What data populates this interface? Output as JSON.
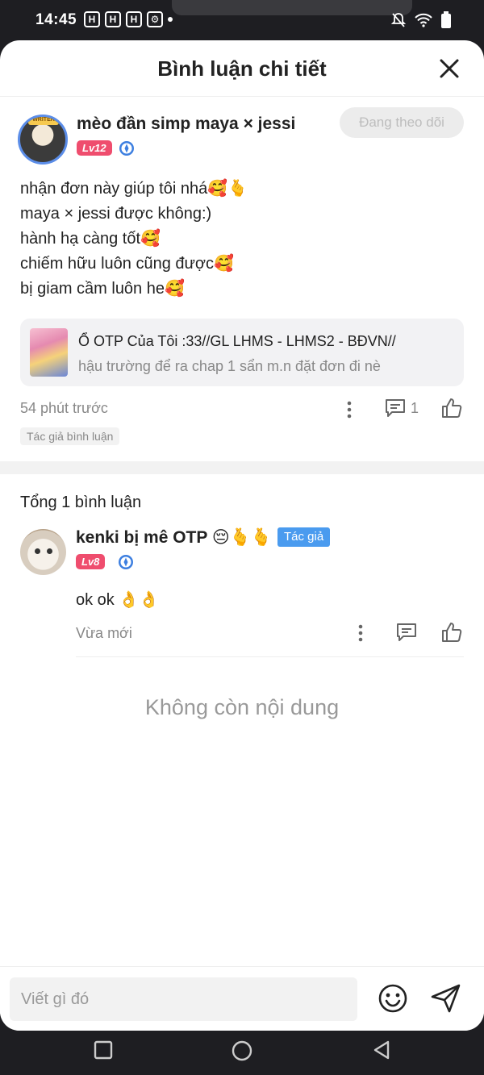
{
  "status_bar": {
    "time": "14:45",
    "notif_icons": [
      "H",
      "H",
      "H",
      "⚙"
    ]
  },
  "header": {
    "title": "Bình luận chi tiết"
  },
  "main_comment": {
    "username": "mèo đần simp maya × jessi",
    "avatar_frame_text": "WRITER",
    "level": "Lv12",
    "follow_label": "Đang theo dõi",
    "lines": [
      "nhận đơn này giúp tôi nhá🥰🫰",
      "maya × jessi được không:)",
      "hành hạ càng tốt🥰",
      "chiếm hữu luôn cũng được🥰",
      "bị giam cầm luôn he🥰"
    ],
    "story": {
      "title": "Ổ OTP Của Tôi :33//GL LHMS - LHMS2 - BĐVN//",
      "subtitle": "hậu trường để ra chap 1 sẩn m.n đặt đơn đi nè"
    },
    "time": "54 phút trước",
    "reply_count": "1",
    "author_chip": "Tác giả bình luận"
  },
  "comments_section": {
    "total_label": "Tổng 1 bình luận",
    "reply": {
      "username": "kenki bị mê OTP 😔🫰🫰",
      "author_tag": "Tác giả",
      "level": "Lv8",
      "text": "ok ok 👌👌",
      "time": "Vừa mới"
    },
    "no_more": "Không còn nội dung"
  },
  "input_bar": {
    "placeholder": "Viết gì đó"
  },
  "colors": {
    "level_badge": "#ef4d6e",
    "author_tag": "#4a9bef",
    "verify": "#3d7fe0"
  }
}
